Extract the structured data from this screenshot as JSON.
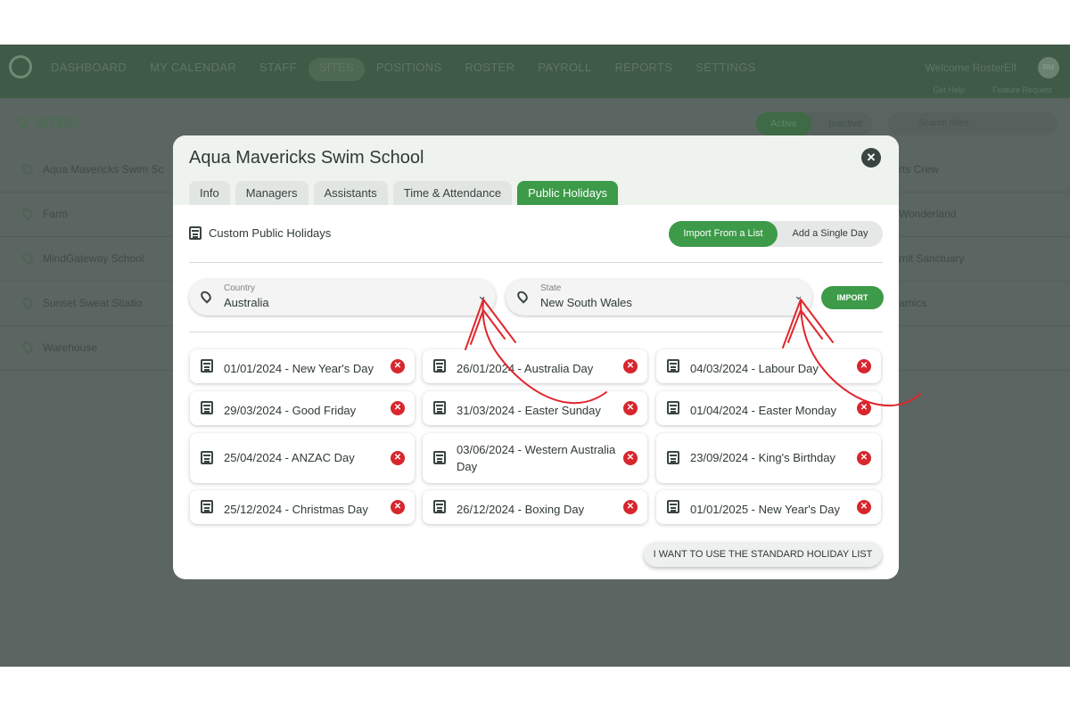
{
  "nav": {
    "links": [
      "DASHBOARD",
      "MY CALENDAR",
      "STAFF",
      "SITES",
      "POSITIONS",
      "ROSTER",
      "PAYROLL",
      "REPORTS",
      "SETTINGS"
    ],
    "active": "SITES",
    "welcome": "Welcome RosterElf",
    "avatar_initials": "RM",
    "get_help": "Get Help",
    "feature_request": "Feature Request"
  },
  "sites": {
    "title": "SITES",
    "filter_active": "Active",
    "filter_inactive": "Inactive",
    "search_placeholder": "Search Sites",
    "rows": [
      {
        "name": "Aqua Mavericks Swim Sc",
        "right": "rts Crew"
      },
      {
        "name": "Farm",
        "right": "Wonderland"
      },
      {
        "name": "MindGateway School",
        "right": "mit Sanctuary"
      },
      {
        "name": "Sunset Sweat Studio",
        "right": "amics"
      },
      {
        "name": "Warehouse",
        "right": ""
      }
    ]
  },
  "modal": {
    "title": "Aqua Mavericks Swim School",
    "tabs": [
      "Info",
      "Managers",
      "Assistants",
      "Time & Attendance",
      "Public Holidays"
    ],
    "active_tab": "Public Holidays",
    "custom_label": "Custom Public Holidays",
    "import_from_list": "Import From a List",
    "add_single_day": "Add a Single Day",
    "country_label": "Country",
    "country_value": "Australia",
    "state_label": "State",
    "state_value": "New South Wales",
    "import_button": "IMPORT",
    "holidays": [
      "01/01/2024 - New Year's Day",
      "26/01/2024 - Australia Day",
      "04/03/2024 - Labour Day",
      "29/03/2024 - Good Friday",
      "31/03/2024 - Easter Sunday",
      "01/04/2024 - Easter Monday",
      "25/04/2024 - ANZAC Day",
      "03/06/2024 - Western Australia Day",
      "23/09/2024 - King's Birthday",
      "25/12/2024 - Christmas Day",
      "26/12/2024 - Boxing Day",
      "01/01/2025 - New Year's Day"
    ],
    "standard_list_button": "I WANT TO USE THE STANDARD HOLIDAY LIST"
  },
  "colors": {
    "accent_green": "#3c9a48",
    "delete_red": "#d7262d",
    "annotation_red": "#e0262c",
    "overlay": "#5b6562"
  }
}
